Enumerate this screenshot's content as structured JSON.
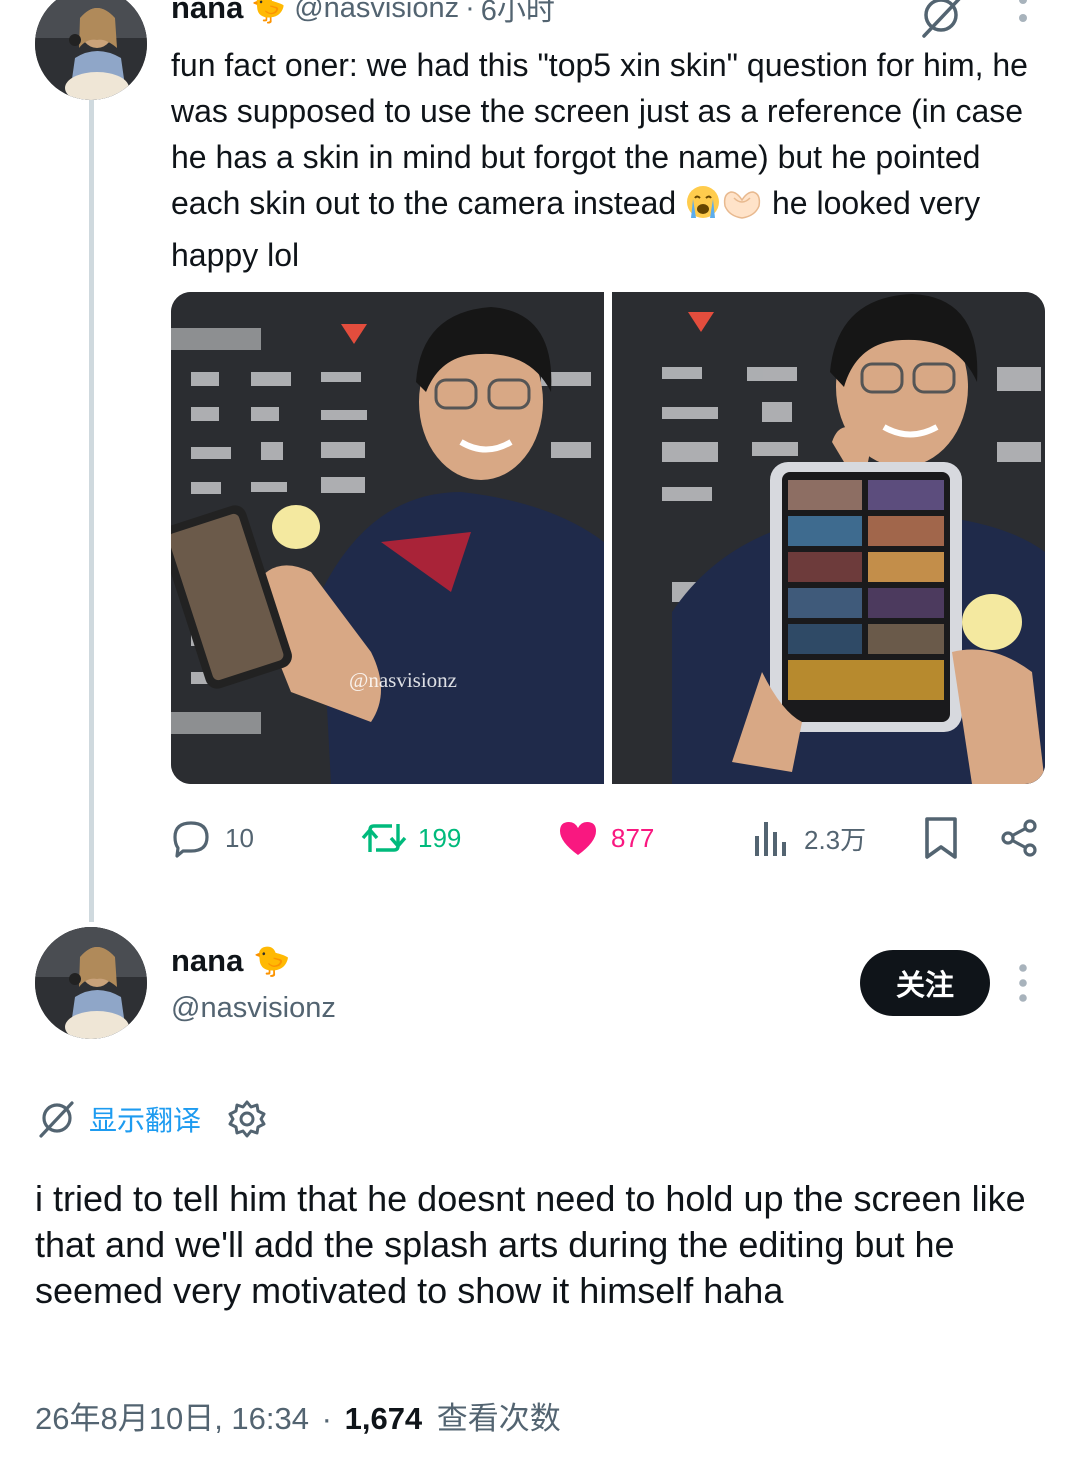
{
  "quoted_tweet": {
    "author_name": "nana",
    "author_emoji": "🐤",
    "handle": "@nasvisionz",
    "separator": "·",
    "time": "6小时",
    "text_before_emoji": "fun fact oner: we had this \"top5 xin skin\" question for him, he was supposed to use the screen just as a reference (in case he has a skin in mind but forgot the name) but he pointed each skin out to the camera instead ",
    "text_after_emoji": " he looked very happy lol",
    "watermark": "@nasvisionz",
    "actions": {
      "replies": "10",
      "retweets": "199",
      "likes": "877",
      "views": "2.3万"
    },
    "colors": {
      "retweet": "#00ba7c",
      "like": "#f91880",
      "muted": "#536471"
    }
  },
  "main_tweet": {
    "author_name": "nana",
    "author_emoji": "🐤",
    "handle": "@nasvisionz",
    "follow_label": "关注",
    "translate_label": "显示翻译",
    "text": "i tried to tell him that he doesnt need to hold up the screen like that and we'll add the splash arts during the editing but he seemed very motivated to show it himself haha",
    "date": "26年8月10日, 16:34",
    "separator": "·",
    "view_count": "1,674",
    "views_label": "查看次数"
  },
  "icons": [
    "translate-icon",
    "more-icon",
    "reply-icon",
    "retweet-icon",
    "like-icon",
    "views-icon",
    "bookmark-icon",
    "share-icon",
    "gear-icon"
  ],
  "accent_color": "#1d9bf0"
}
